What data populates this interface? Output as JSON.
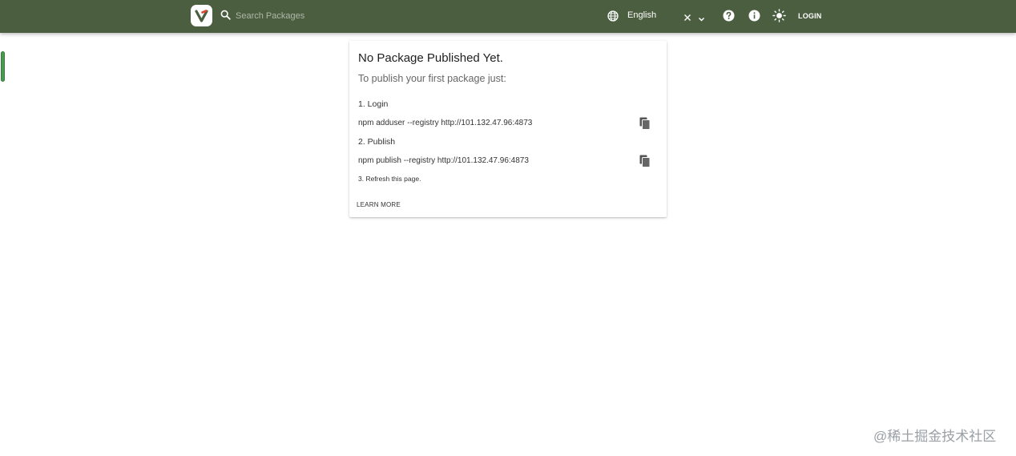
{
  "header": {
    "search_placeholder": "Search Packages",
    "language": "English",
    "login_label": "LOGIN"
  },
  "card": {
    "title": "No Package Published Yet.",
    "subtitle": "To publish your first package just:",
    "steps": [
      {
        "label": "1. Login",
        "command": "npm adduser --registry http://101.132.47.96:4873"
      },
      {
        "label": "2. Publish",
        "command": "npm publish --registry http://101.132.47.96:4873"
      }
    ],
    "refresh_note": "3. Refresh this page.",
    "learn_more": "LEARN MORE"
  },
  "watermark": "@稀土掘金技术社区",
  "colors": {
    "header_bg": "#4b5e40",
    "accent_green": "#4a9a52",
    "logo_red": "#e0482b"
  },
  "icons": [
    "verdaccio-logo-icon",
    "search-icon",
    "globe-icon",
    "clear-icon",
    "chevron-down-icon",
    "help-icon",
    "info-icon",
    "theme-sun-icon",
    "copy-icon"
  ]
}
